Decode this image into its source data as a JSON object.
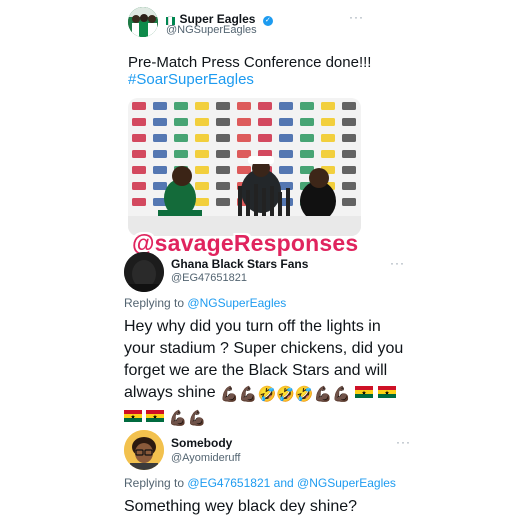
{
  "tweet1": {
    "author_name": "Super Eagles",
    "author_handle": "@NGSuperEagles",
    "text": "Pre-Match Press Conference done!!!",
    "hashtag": "#SoarSuperEagles",
    "more": "···"
  },
  "watermark": "@savageResponses",
  "reply1": {
    "author_name": "Ghana Black Stars Fans",
    "author_handle": "@EG47651821",
    "replying_prefix": "Replying to",
    "replying_to": "@NGSuperEagles",
    "text_line1": "Hey why did you turn off the lights in",
    "text_line2": "your stadium ? Super chickens, did you",
    "text_line3": "forget we are the Black Stars and will",
    "text_line4": "always shine",
    "more": "···",
    "emoji": {
      "flexed_biceps": "💪🏿",
      "rofl": "🤣",
      "ghana_flag": "ghana-flag"
    }
  },
  "reply2": {
    "author_name": "Somebody",
    "author_handle": "@Ayomideruff",
    "replying_prefix": "Replying to",
    "replying_to_1": "@EG47651821",
    "replying_and": "and",
    "replying_to_2": "@NGSuperEagles",
    "text": "Something wey black dey shine?",
    "more": "···"
  },
  "colors": {
    "link": "#1d9bf0",
    "watermark": "#e0245e",
    "secondary_text": "#536471",
    "nigeria_green": "#008751",
    "ghana_red": "#ce1126",
    "ghana_gold": "#fcd116",
    "ghana_green": "#006b3f"
  }
}
